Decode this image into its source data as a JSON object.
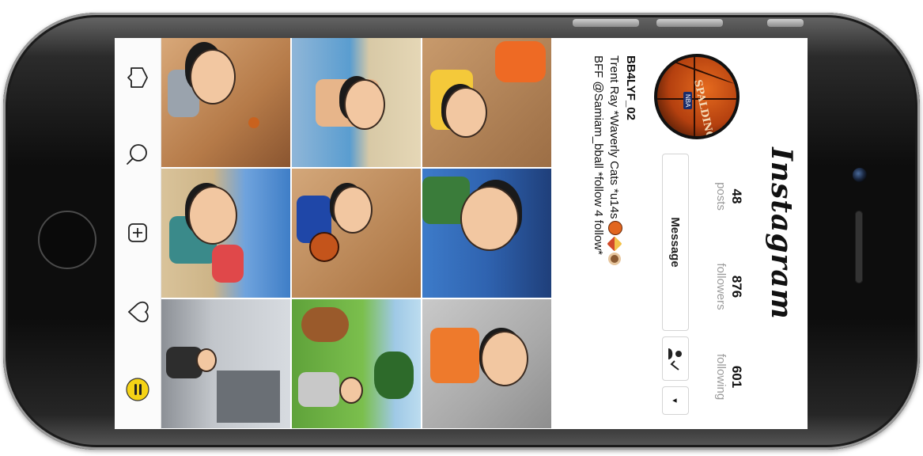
{
  "app": {
    "logo": "Instagram"
  },
  "profile": {
    "avatar_alt": "Spalding NBA basketball",
    "avatar_brand": "SPALDING",
    "avatar_badge": "NBA",
    "stats": [
      {
        "key": "posts",
        "value": "48",
        "label": "posts"
      },
      {
        "key": "followers",
        "value": "876",
        "label": "followers"
      },
      {
        "key": "following",
        "value": "601",
        "label": "following"
      }
    ],
    "message_button": "Message",
    "follow_icon": "following-check-icon",
    "more_icon": "dropdown-arrow-icon",
    "more_glyph": "▾",
    "username": "BB4LYF_02",
    "bio_line1": "Trent Ray *Waverly Cats *u14s",
    "bio_line1_emojis": [
      "basketball-emoji",
      "pizza-emoji",
      "monkey-emoji"
    ],
    "bio_line2": "BFF @Samiam_bball *follow 4 follow*"
  },
  "tabbar": {
    "items": [
      "inbox-icon",
      "search-icon",
      "new-post-icon",
      "activity-heart-icon",
      "profile-bitmoji-icon"
    ]
  },
  "grid": {
    "tiles": [
      "bitmoji-basketball-court",
      "bitmoji-beach-swim",
      "bitmoji-foam-finger-arena",
      "bitmoji-beach-friends",
      "bitmoji-dribble-warriors",
      "bitmoji-outdoor-court",
      "bitmoji-building-suit",
      "bitmoji-dog-park",
      "bitmoji-orange-shirt-office"
    ]
  },
  "colors": {
    "accent_yellow": "#f5d316",
    "basketball_orange": "#d2561a",
    "muted_text": "#9a9a9a"
  }
}
